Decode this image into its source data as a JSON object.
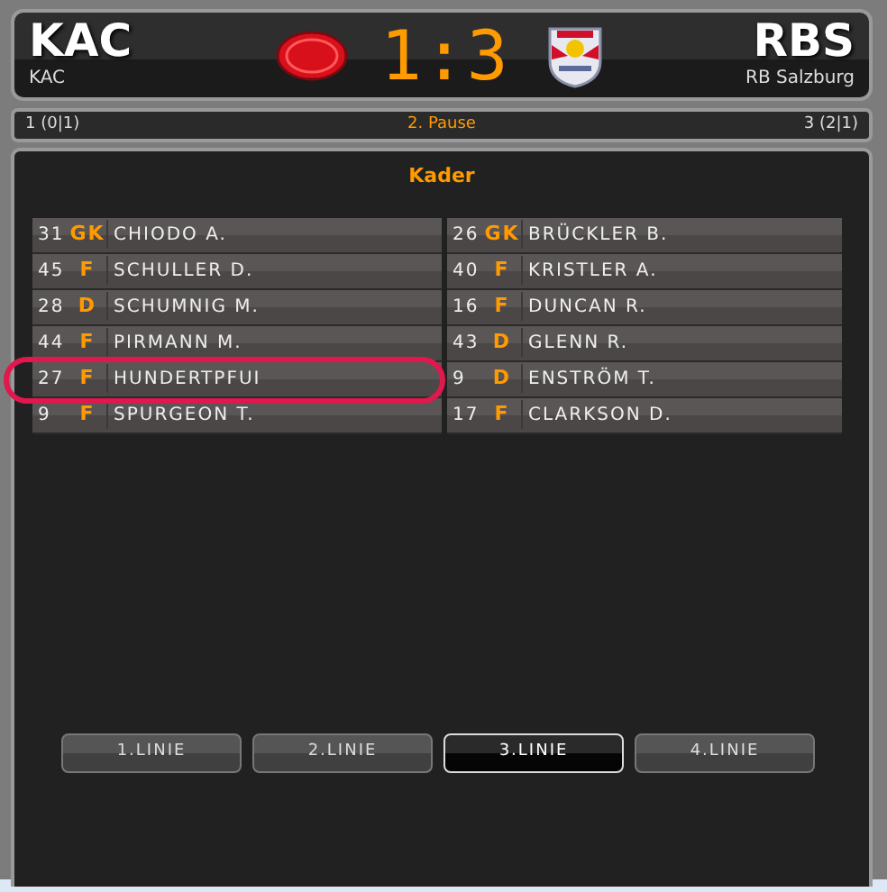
{
  "home": {
    "abbr": "KAC",
    "name": "KAC"
  },
  "score": "1:3",
  "away": {
    "abbr": "RBS",
    "name": "RB Salzburg"
  },
  "status": {
    "home_periods": "1 (0|1)",
    "period": "2. Pause",
    "away_periods": "3 (2|1)"
  },
  "roster": {
    "title": "Kader",
    "home": [
      {
        "number": "31",
        "position": "GK",
        "name": "CHIODO A."
      },
      {
        "number": "45",
        "position": "F",
        "name": "SCHULLER D."
      },
      {
        "number": "28",
        "position": "D",
        "name": "SCHUMNIG M."
      },
      {
        "number": "44",
        "position": "F",
        "name": "PIRMANN M."
      },
      {
        "number": "27",
        "position": "F",
        "name": "HUNDERTPFUI"
      },
      {
        "number": "9",
        "position": "F",
        "name": "SPURGEON T."
      }
    ],
    "away": [
      {
        "number": "26",
        "position": "GK",
        "name": "BRÜCKLER B."
      },
      {
        "number": "40",
        "position": "F",
        "name": "KRISTLER A."
      },
      {
        "number": "16",
        "position": "F",
        "name": "DUNCAN R."
      },
      {
        "number": "43",
        "position": "D",
        "name": "GLENN R."
      },
      {
        "number": "9",
        "position": "D",
        "name": "ENSTRÖM T."
      },
      {
        "number": "17",
        "position": "F",
        "name": "CLARKSON D."
      }
    ]
  },
  "lines": [
    {
      "label": "1.LINIE",
      "selected": false
    },
    {
      "label": "2.LINIE",
      "selected": false
    },
    {
      "label": "3.LINIE",
      "selected": true
    },
    {
      "label": "4.LINIE",
      "selected": false
    }
  ]
}
